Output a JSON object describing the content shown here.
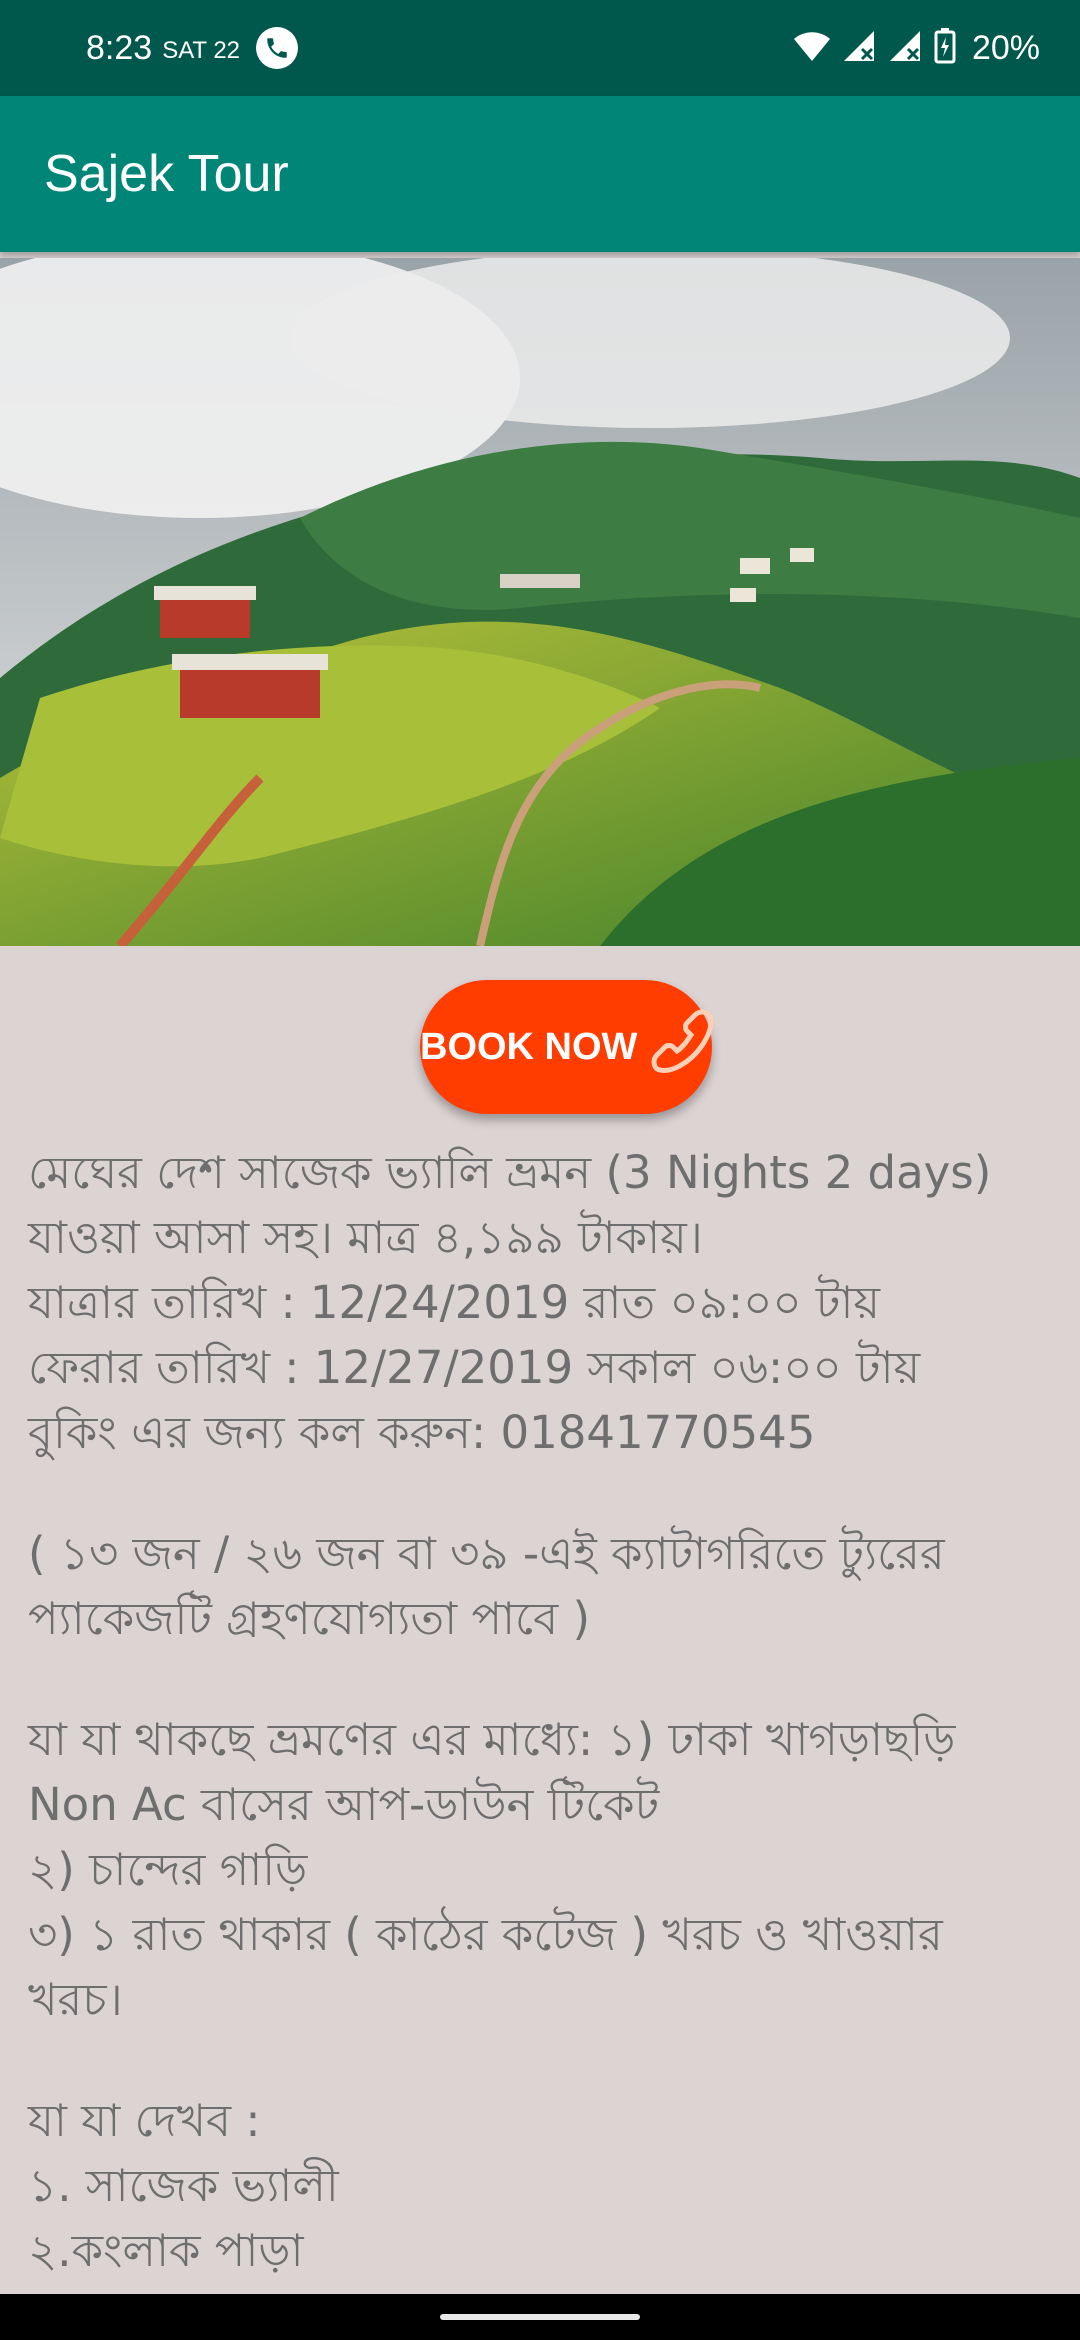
{
  "status_bar": {
    "time": "8:23",
    "date": "SAT 22",
    "battery": "20%",
    "icons": [
      "phone-call-icon",
      "wifi-icon",
      "signal-icon",
      "signal-icon",
      "battery-charging-icon"
    ]
  },
  "app_bar": {
    "title": "Sajek Tour"
  },
  "hero": {
    "description": "hillside-landscape-photo"
  },
  "book_button": {
    "label": "BOOK NOW",
    "icon": "phone-handset-icon",
    "color": "#ff3d00"
  },
  "content": {
    "line1": "মেঘের দেশ সাজেক ভ্যালি ভ্রমন (3 Nights 2 days)",
    "line2": "যাওয়া আসা সহ। মাত্র ৪,১৯৯ টাকায়।",
    "line3": "যাত্রার তারিখ : 12/24/2019 রাত ০৯:০০ টায়",
    "line4": "ফেরার তারিখ : 12/27/2019 সকাল ০৬:০০ টায়",
    "line5": "বুকিং এর জন্য কল করুন: 01841770545",
    "line6": "( ১৩ জন / ২৬ জন বা ৩৯ -এই ক্যাটাগরিতে ট্যুরের",
    "line7": "প্যাকেজটি গ্রহণযোগ্যতা পাবে )",
    "line8": "যা যা থাকছে ভ্রমণের এর মাধ্যে: ১) ঢাকা খাগড়াছড়ি",
    "line9": "Non Ac বাসের আপ-ডাউন টিকেট",
    "line10": "২) চান্দের গাড়ি",
    "line11": "৩) ১ রাত থাকার ( কাঠের কটেজ ) খরচ ও খাওয়ার",
    "line12": "খরচ।",
    "line13": "যা যা দেখব :",
    "line14": "১. সাজেক ভ্যালী",
    "line15": "২.কংলাক পাড়া"
  },
  "colors": {
    "status_bar": "#00574b",
    "app_bar": "#008577",
    "background": "#dcd3d3",
    "text": "#6e6e6e"
  }
}
